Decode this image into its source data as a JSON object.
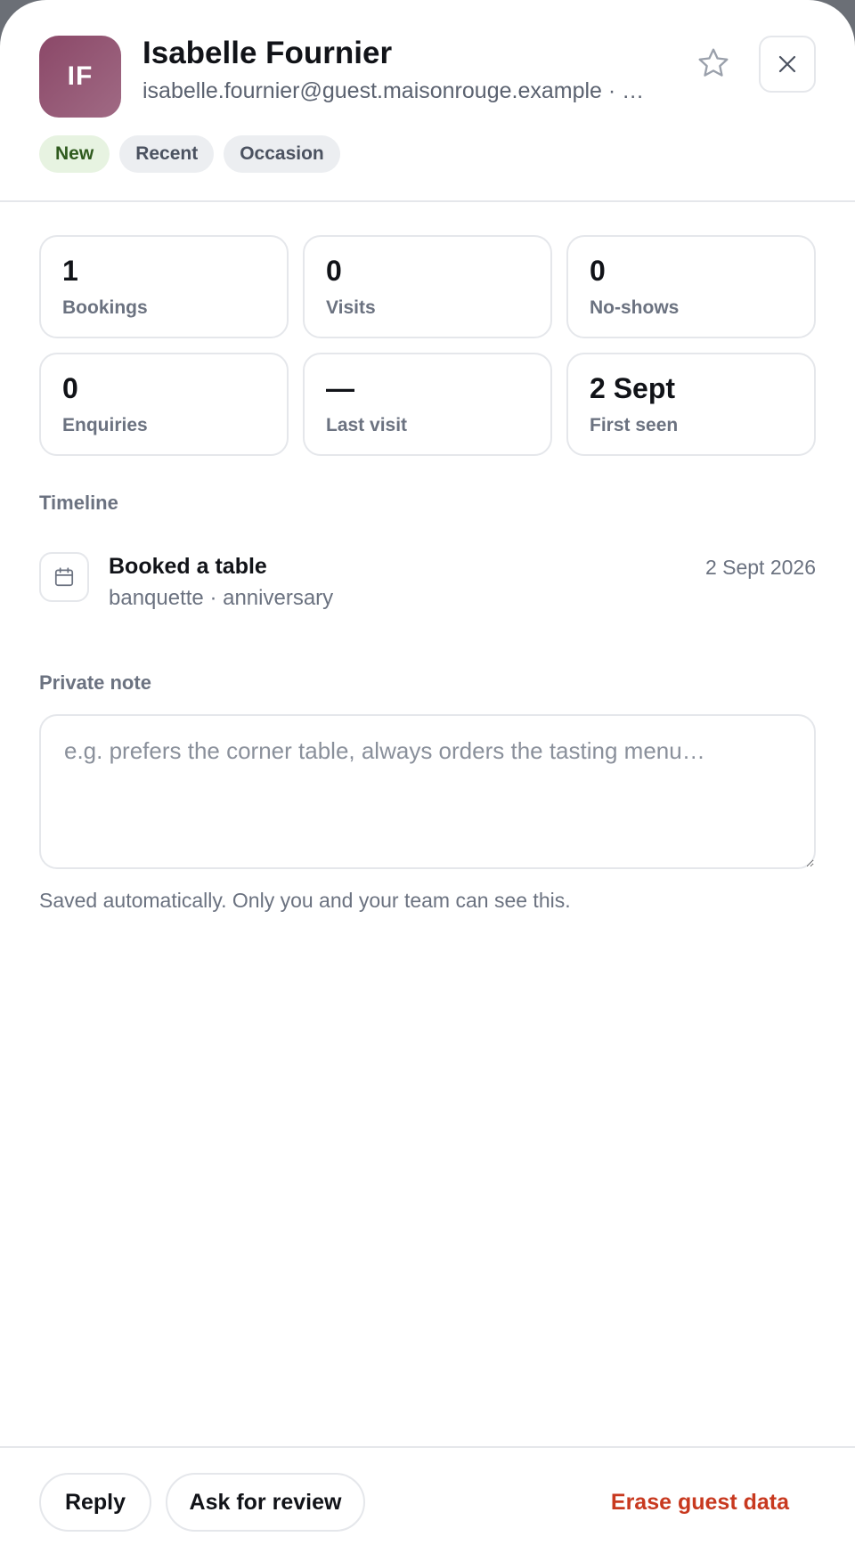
{
  "guest": {
    "initials": "IF",
    "name": "Isabelle Fournier",
    "email": "isabelle.fournier@guest.maisonrouge.example · …"
  },
  "tags": [
    "New",
    "Recent",
    "Occasion"
  ],
  "stats": [
    {
      "value": "1",
      "label": "Bookings"
    },
    {
      "value": "0",
      "label": "Visits"
    },
    {
      "value": "0",
      "label": "No-shows"
    },
    {
      "value": "0",
      "label": "Enquiries"
    },
    {
      "value": "—",
      "label": "Last visit"
    },
    {
      "value": "2 Sept",
      "label": "First seen"
    }
  ],
  "timeline": {
    "title": "Timeline",
    "items": [
      {
        "icon": "calendar-icon",
        "title": "Booked a table",
        "subtitle": "banquette · anniversary",
        "date": "2 Sept 2026"
      }
    ]
  },
  "note": {
    "title": "Private note",
    "value": "",
    "placeholder": "e.g. prefers the corner table, always orders the tasting menu…",
    "hint": "Saved automatically. Only you and your team can see this."
  },
  "footer": {
    "reply_label": "Reply",
    "review_label": "Ask for review",
    "erase_label": "Erase guest data"
  },
  "colors": {
    "avatar": "#8b4868",
    "tag_new_bg": "#e7f3e1",
    "danger": "#c8391f"
  }
}
